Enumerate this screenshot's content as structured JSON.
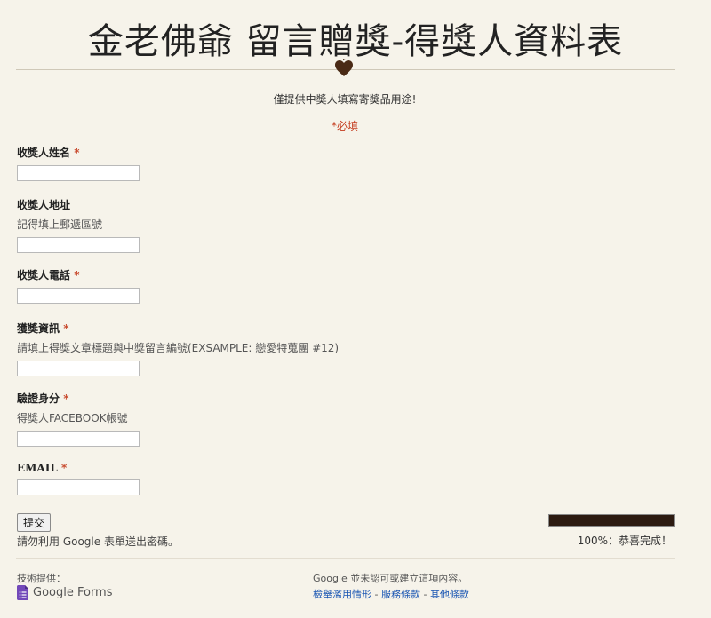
{
  "form": {
    "title": "金老佛爺 留言贈獎-得獎人資料表",
    "description": "僅提供中獎人填寫寄獎品用途!",
    "required_note": "*必填"
  },
  "questions": [
    {
      "label": "收獎人姓名",
      "required_mark": "*",
      "help": "",
      "value": ""
    },
    {
      "label": "收獎人地址",
      "required_mark": "",
      "help": "記得填上郵遞區號",
      "value": ""
    },
    {
      "label": "收獎人電話",
      "required_mark": "*",
      "help": "",
      "value": ""
    },
    {
      "label": "獲獎資訊",
      "required_mark": "*",
      "help": "請填上得獎文章標題與中獎留言編號(EXSAMPLE: 戀愛特蒐團 #12)",
      "value": ""
    },
    {
      "label": "驗證身分",
      "required_mark": "*",
      "help": "得獎人FACEBOOK帳號",
      "value": ""
    },
    {
      "label": "EMAIL",
      "required_mark": "*",
      "help": "",
      "value": ""
    }
  ],
  "actions": {
    "submit_label": "提交",
    "password_warning": "請勿利用 Google 表單送出密碼。"
  },
  "progress": {
    "percent": 100,
    "text": "100%：恭喜完成！",
    "fill_color": "#2c1a10"
  },
  "footer": {
    "powered_by": "技術提供：",
    "product": "Google Forms",
    "disclaimer": "Google 並未認可或建立這項內容。",
    "report_link": "檢舉濫用情形",
    "terms_link": "服務條款",
    "other_link": "其他條款",
    "separator": " - "
  },
  "colors": {
    "background": "#f6f3ea",
    "required": "#c43b1d",
    "link": "#1a56b3",
    "forms_icon": "#7248b9"
  }
}
